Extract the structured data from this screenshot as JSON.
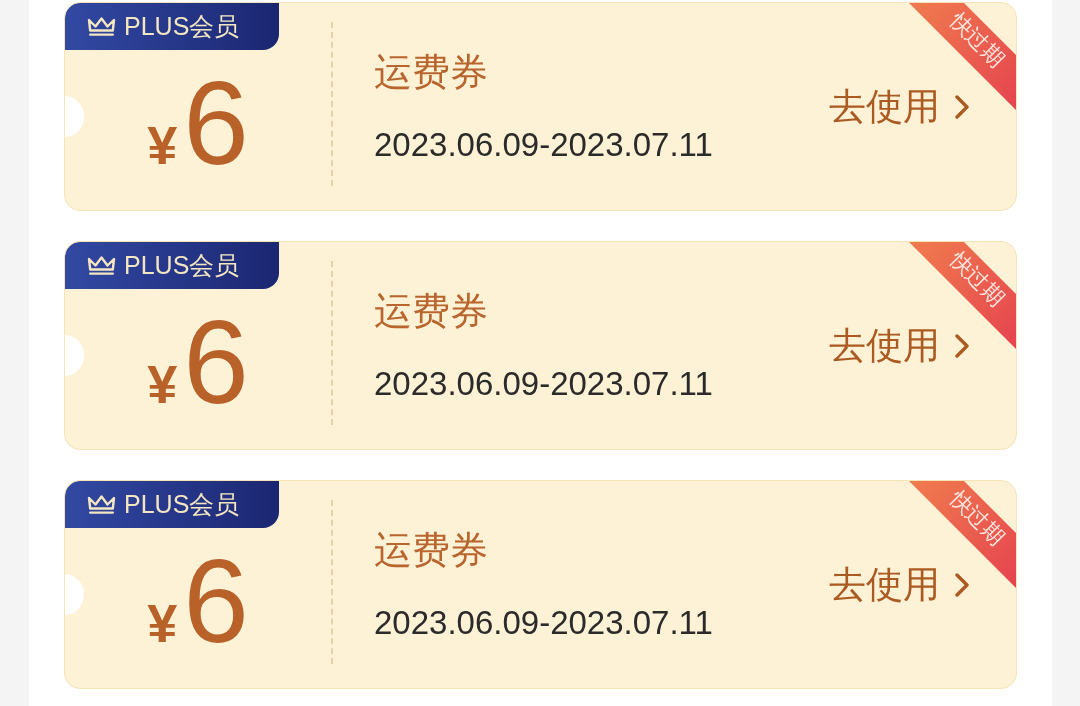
{
  "coupons": [
    {
      "badge": "PLUS会员",
      "currency": "¥",
      "amount": "6",
      "title": "运费券",
      "validity": "2023.06.09-2023.07.11",
      "action": "去使用",
      "ribbon": "快过期"
    },
    {
      "badge": "PLUS会员",
      "currency": "¥",
      "amount": "6",
      "title": "运费券",
      "validity": "2023.06.09-2023.07.11",
      "action": "去使用",
      "ribbon": "快过期"
    },
    {
      "badge": "PLUS会员",
      "currency": "¥",
      "amount": "6",
      "title": "运费券",
      "validity": "2023.06.09-2023.07.11",
      "action": "去使用",
      "ribbon": "快过期"
    }
  ]
}
